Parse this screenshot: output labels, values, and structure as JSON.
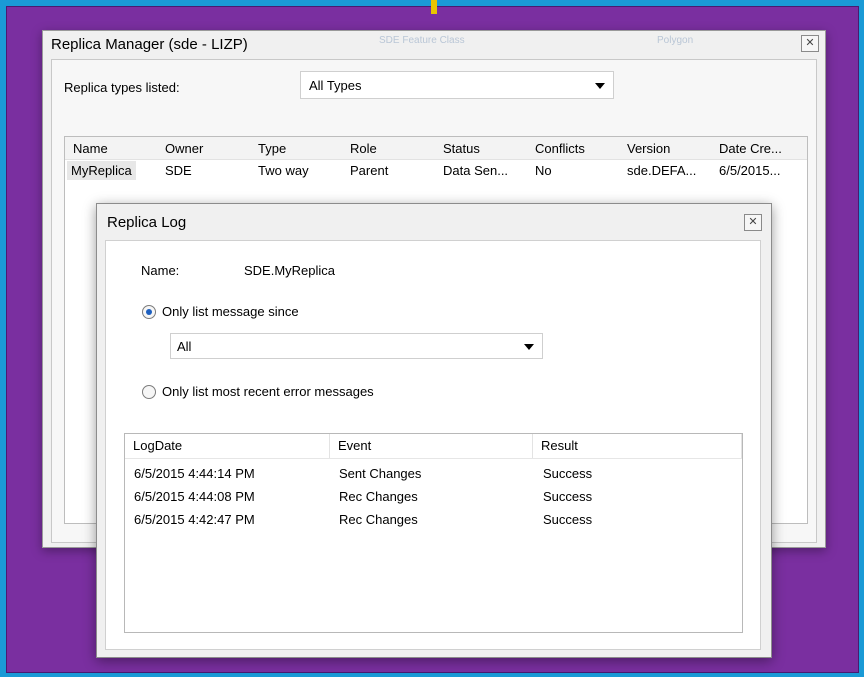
{
  "colors": {
    "background": "#1a9ad6",
    "frame": "#7a2fa0",
    "marker": "#e8c400"
  },
  "replica_manager": {
    "title": "Replica Manager (sde - LIZP)",
    "ghost_texts": [
      "SDE Feature Class",
      "Polygon"
    ],
    "types_label": "Replica types listed:",
    "types_value": "All Types",
    "columns": [
      "Name",
      "Owner",
      "Type",
      "Role",
      "Status",
      "Conflicts",
      "Version",
      "Date Cre..."
    ],
    "rows": [
      [
        "MyReplica",
        "SDE",
        "Two way",
        "Parent",
        "Data Sen...",
        "No",
        "sde.DEFA...",
        "6/5/2015..."
      ]
    ]
  },
  "replica_log": {
    "title": "Replica Log",
    "name_label": "Name:",
    "name_value": "SDE.MyReplica",
    "option_since_label": "Only list message since",
    "option_since_selected": true,
    "since_value": "All",
    "option_errors_label": "Only list most recent error messages",
    "option_errors_selected": false,
    "columns": [
      "LogDate",
      "Event",
      "Result"
    ],
    "rows": [
      [
        "6/5/2015 4:44:14 PM",
        "Sent Changes",
        "Success"
      ],
      [
        "6/5/2015 4:44:08 PM",
        "Rec Changes",
        "Success"
      ],
      [
        "6/5/2015 4:42:47 PM",
        "Rec Changes",
        "Success"
      ]
    ]
  },
  "icons": {
    "close": "close-icon",
    "dropdown": "chevron-down-icon"
  }
}
